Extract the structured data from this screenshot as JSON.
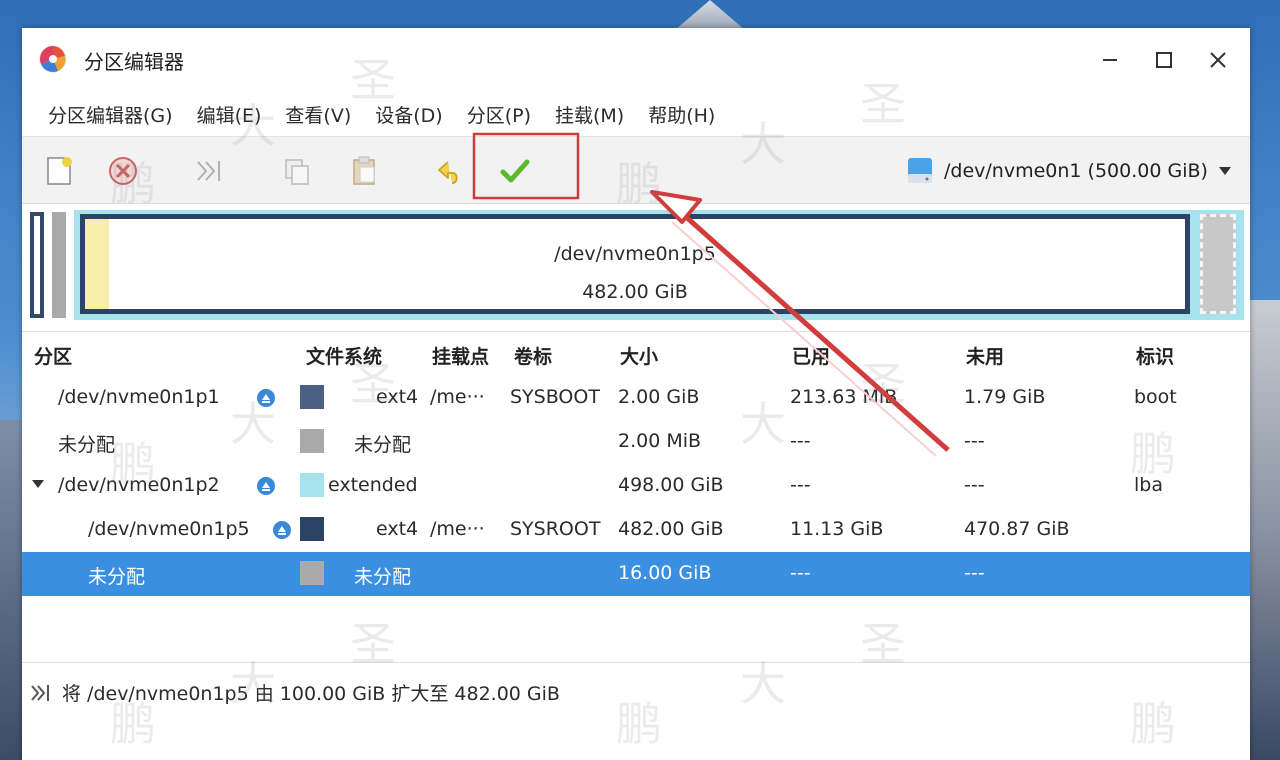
{
  "window": {
    "title": "分区编辑器",
    "controls": {
      "minimize": "minimize",
      "maximize": "maximize",
      "close": "close"
    }
  },
  "menu": [
    "分区编辑器(G)",
    "编辑(E)",
    "查看(V)",
    "设备(D)",
    "分区(P)",
    "挂载(M)",
    "帮助(H)"
  ],
  "toolbar": {
    "buttons": [
      "new-partition-icon",
      "delete-icon",
      "resize-move-icon",
      "copy-icon",
      "paste-icon",
      "undo-icon",
      "apply-checkmark-icon"
    ],
    "device": "/dev/nvme0n1 (500.00 GiB)"
  },
  "graph": {
    "partition_label": "/dev/nvme0n1p5",
    "partition_size": "482.00 GiB"
  },
  "table": {
    "headers": {
      "partition": "分区",
      "filesystem": "文件系统",
      "mountpoint": "挂载点",
      "label": "卷标",
      "size": "大小",
      "used": "已用",
      "unused": "未用",
      "flags": "标识"
    },
    "rows": [
      {
        "partition": "/dev/nvme0n1p1",
        "filesystem": "ext4",
        "mountpoint": "/me···",
        "label": "SYSBOOT",
        "size": "2.00 GiB",
        "used": "213.63 MiB",
        "unused": "1.79 GiB",
        "flags": "boot",
        "color": "#4a5f82"
      },
      {
        "partition": "未分配",
        "filesystem": "未分配",
        "mountpoint": "",
        "label": "",
        "size": "2.00 MiB",
        "used": "---",
        "unused": "---",
        "flags": "",
        "color": "#aaaaaa"
      },
      {
        "partition": "/dev/nvme0n1p2",
        "filesystem": "extended",
        "mountpoint": "",
        "label": "",
        "size": "498.00 GiB",
        "used": "---",
        "unused": "---",
        "flags": "lba",
        "color": "#a6e3ec"
      },
      {
        "partition": "/dev/nvme0n1p5",
        "filesystem": "ext4",
        "mountpoint": "/me···",
        "label": "SYSROOT",
        "size": "482.00 GiB",
        "used": "11.13 GiB",
        "unused": "470.87 GiB",
        "flags": "",
        "color": "#2b4365"
      },
      {
        "partition": "未分配",
        "filesystem": "未分配",
        "mountpoint": "",
        "label": "",
        "size": "16.00 GiB",
        "used": "---",
        "unused": "---",
        "flags": "",
        "color": "#aaaaaa"
      }
    ]
  },
  "operations": [
    "将 /dev/nvme0n1p5 由 100.00 GiB 扩大至 482.00 GiB"
  ],
  "watermark": "鹏大圣",
  "colors": {
    "selection": "#3b8fe0",
    "highlight_box": "#d23c3c",
    "arrow": "#d23c3c"
  }
}
